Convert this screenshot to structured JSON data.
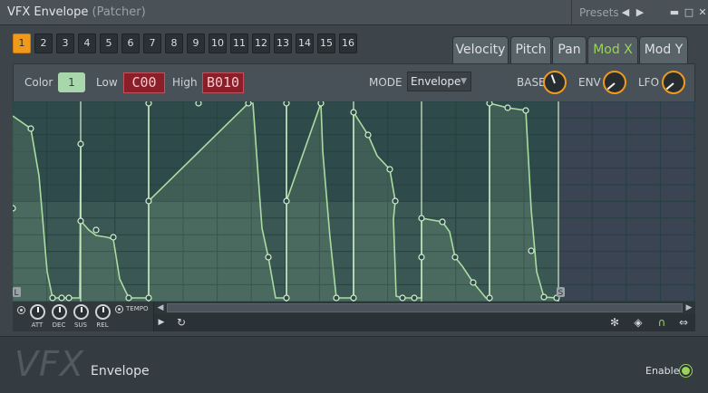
{
  "window": {
    "title": "VFX Envelope",
    "subtitle": "(Patcher)",
    "presets_label": "Presets",
    "prev": "◀",
    "next": "▶",
    "minimize": "▬",
    "maximize": "□",
    "close": "✕"
  },
  "numbers": [
    "1",
    "2",
    "3",
    "4",
    "5",
    "6",
    "7",
    "8",
    "9",
    "10",
    "11",
    "12",
    "13",
    "14",
    "15",
    "16"
  ],
  "active_number": 0,
  "tabs": [
    "Velocity",
    "Pitch",
    "Pan",
    "Mod X",
    "Mod Y"
  ],
  "active_tab": 3,
  "controls": {
    "color_label": "Color",
    "color_value": "1",
    "low_label": "Low",
    "low_value": "C00",
    "high_label": "High",
    "high_value": "B010",
    "mode_label": "MODE",
    "mode_value": "Envelope",
    "base_label": "BASE",
    "env_label": "ENV",
    "lfo_label": "LFO"
  },
  "env_knobs": [
    "ATT",
    "DEC",
    "SUS",
    "REL"
  ],
  "tempo_label": "TEMPO",
  "markers": {
    "loop": "L",
    "sustain": "S"
  },
  "bottom": {
    "brand": "VFX",
    "name": "Envelope",
    "enable_label": "Enable"
  },
  "colors": {
    "accent": "#f09a1c",
    "envelope": "#a9dca0",
    "active_tab": "#9bd25a",
    "note_box": "#8a1f2a"
  }
}
